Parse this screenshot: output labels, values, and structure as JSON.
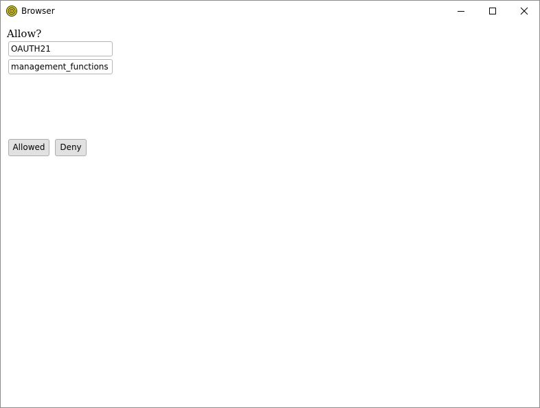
{
  "window": {
    "title": "Browser",
    "icon": "browser-app-icon",
    "controls": {
      "minimize": "minimize-icon",
      "maximize": "maximize-icon",
      "close": "close-icon"
    }
  },
  "dialog": {
    "prompt": "Allow?",
    "client_id_value": "OAUTH21",
    "scope_value": "management_functions",
    "allow_label": "Allowed",
    "deny_label": "Deny"
  },
  "colors": {
    "icon_yellow": "#f2e600",
    "icon_ring": "#2b2b2b",
    "button_face": "#e1e1e1",
    "field_border": "#b5b5b5"
  }
}
